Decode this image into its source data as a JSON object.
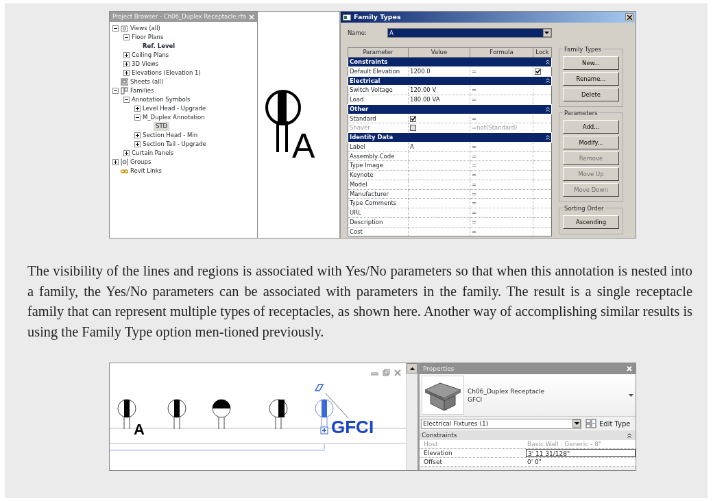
{
  "top_figure": {
    "project_browser": {
      "title": "Project Browser - Ch06_Duplex Receptacle.rfa",
      "tree": [
        {
          "label": "Views (all)",
          "kind": "views",
          "expanded": true,
          "selected": false,
          "current": false,
          "children": [
            {
              "label": "Floor Plans",
              "expanded": true,
              "selected": false,
              "current": false,
              "children": [
                {
                  "label": "Ref. Level",
                  "selected": false,
                  "current": true
                }
              ]
            },
            {
              "label": "Ceiling Plans",
              "expanded": false,
              "selected": false,
              "current": false
            },
            {
              "label": "3D Views",
              "expanded": false,
              "selected": false,
              "current": false
            },
            {
              "label": "Elevations (Elevation 1)",
              "expanded": false,
              "selected": false,
              "current": false
            }
          ]
        },
        {
          "label": "Sheets (all)",
          "kind": "sheets",
          "selected": false,
          "current": false
        },
        {
          "label": "Families",
          "kind": "families",
          "expanded": true,
          "selected": false,
          "current": false,
          "children": [
            {
              "label": "Annotation Symbols",
              "expanded": true,
              "selected": false,
              "current": false,
              "children": [
                {
                  "label": "Level Head - Upgrade",
                  "expanded": false,
                  "selected": false,
                  "current": false
                },
                {
                  "label": "M_Duplex Annotation",
                  "expanded": true,
                  "selected": false,
                  "current": false,
                  "children": [
                    {
                      "label": "STD",
                      "selected": true,
                      "current": false
                    }
                  ]
                },
                {
                  "label": "Section Head - Min",
                  "expanded": false,
                  "selected": false,
                  "current": false
                },
                {
                  "label": "Section Tail - Upgrade",
                  "expanded": false,
                  "selected": false,
                  "current": false
                }
              ]
            },
            {
              "label": "Curtain Panels",
              "expanded": false,
              "selected": false,
              "current": false
            }
          ]
        },
        {
          "label": "Groups",
          "kind": "groups",
          "expanded": false,
          "selected": false,
          "current": false
        },
        {
          "label": "Revit Links",
          "kind": "links",
          "selected": false,
          "current": false
        }
      ]
    },
    "preview": {
      "tag": "A"
    },
    "family_types": {
      "title": "Family Types",
      "name_label": "Name:",
      "name_value": "A",
      "columns": [
        "Parameter",
        "Value",
        "Formula",
        "Lock"
      ],
      "groups": [
        {
          "title": "Constraints",
          "rows": [
            {
              "parameter": "Default Elevation",
              "kind": "text",
              "value": "1200.0",
              "formula": "=",
              "lock": true,
              "disabled": false
            }
          ]
        },
        {
          "title": "Electrical",
          "rows": [
            {
              "parameter": "Switch Voltage",
              "kind": "text",
              "value": "120.00 V",
              "formula": "=",
              "disabled": false
            },
            {
              "parameter": "Load",
              "kind": "text",
              "value": "180.00 VA",
              "formula": "=",
              "disabled": false
            }
          ]
        },
        {
          "title": "Other",
          "rows": [
            {
              "parameter": "Standard",
              "kind": "check",
              "checked": true,
              "formula": "=",
              "disabled": false
            },
            {
              "parameter": "Shaver",
              "kind": "check",
              "checked": false,
              "formula": "=not(Standard)",
              "disabled": true
            }
          ]
        },
        {
          "title": "Identity Data",
          "rows": [
            {
              "parameter": "Label",
              "kind": "text",
              "value": "A",
              "formula": "=",
              "disabled": false
            },
            {
              "parameter": "Assembly Code",
              "kind": "text",
              "formula": "=",
              "disabled": false
            },
            {
              "parameter": "Type Image",
              "kind": "text",
              "formula": "=",
              "disabled": false
            },
            {
              "parameter": "Keynote",
              "kind": "text",
              "formula": "=",
              "disabled": false
            },
            {
              "parameter": "Model",
              "kind": "text",
              "formula": "=",
              "disabled": false
            },
            {
              "parameter": "Manufacturer",
              "kind": "text",
              "formula": "=",
              "disabled": false
            },
            {
              "parameter": "Type Comments",
              "kind": "text",
              "formula": "=",
              "disabled": false
            },
            {
              "parameter": "URL",
              "kind": "text",
              "formula": "=",
              "disabled": false
            },
            {
              "parameter": "Description",
              "kind": "text",
              "formula": "=",
              "disabled": false
            },
            {
              "parameter": "Cost",
              "kind": "text",
              "formula": "=",
              "disabled": false
            }
          ]
        }
      ],
      "button_groups": [
        {
          "title": "Family Types",
          "buttons": [
            {
              "label": "New...",
              "disabled": false
            },
            {
              "label": "Rename...",
              "disabled": false
            },
            {
              "label": "Delete",
              "disabled": false
            }
          ]
        },
        {
          "title": "Parameters",
          "buttons": [
            {
              "label": "Add...",
              "disabled": false
            },
            {
              "label": "Modify...",
              "disabled": false
            },
            {
              "label": "Remove",
              "disabled": true
            },
            {
              "label": "Move Up",
              "disabled": true
            },
            {
              "label": "Move Down",
              "disabled": true
            }
          ]
        },
        {
          "title": "Sorting Order",
          "buttons": [
            {
              "label": "Ascending",
              "disabled": false
            }
          ]
        }
      ]
    }
  },
  "paragraph": "The visibility of the lines and regions is associated with Yes/No parameters so that when this annotation is nested into a family, the Yes/No parameters can be associated with parameters in the family. The result is a single receptacle family that can represent multiple types of receptacles, as shown here. Another way of accomplishing similar results is using the Family Type option men-tioned previously.",
  "bottom_figure": {
    "view": {
      "symbols": [
        {
          "kind": "left",
          "tag": "A",
          "selected": false
        },
        {
          "kind": "left",
          "selected": false
        },
        {
          "kind": "top",
          "selected": false
        },
        {
          "kind": "right",
          "selected": false
        },
        {
          "kind": "left",
          "tag": "GFCI",
          "selected": true
        }
      ]
    },
    "properties": {
      "title": "Properties",
      "family": "Ch06_Duplex Receptacle",
      "type": "GFCI",
      "category": "Electrical Fixtures (1)",
      "edit_type": "Edit Type",
      "section": "Constraints",
      "rows": [
        {
          "name": "Host",
          "value": "Basic Wall : Generic - 8\"",
          "disabled": true,
          "editing": false
        },
        {
          "name": "Elevation",
          "value": "3'  11 31/128\"",
          "disabled": false,
          "editing": true
        },
        {
          "name": "Offset",
          "value": "0'  0\"",
          "disabled": false,
          "editing": false
        }
      ]
    }
  }
}
